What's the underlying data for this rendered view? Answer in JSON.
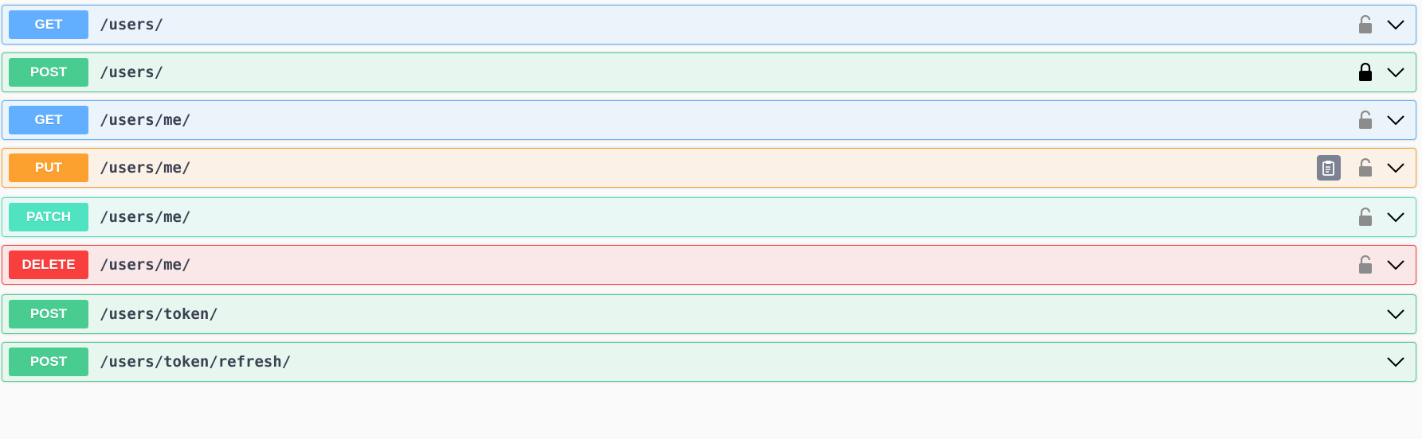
{
  "operations": [
    {
      "method": "GET",
      "path": "/users/",
      "lock": "unlocked",
      "copy": false
    },
    {
      "method": "POST",
      "path": "/users/",
      "lock": "locked",
      "copy": false
    },
    {
      "method": "GET",
      "path": "/users/me/",
      "lock": "unlocked",
      "copy": false
    },
    {
      "method": "PUT",
      "path": "/users/me/",
      "lock": "unlocked",
      "copy": true
    },
    {
      "method": "PATCH",
      "path": "/users/me/",
      "lock": "unlocked",
      "copy": false
    },
    {
      "method": "DELETE",
      "path": "/users/me/",
      "lock": "unlocked",
      "copy": false
    },
    {
      "method": "POST",
      "path": "/users/token/",
      "lock": "none",
      "copy": false
    },
    {
      "method": "POST",
      "path": "/users/token/refresh/",
      "lock": "none",
      "copy": false
    }
  ],
  "colors": {
    "get": "#61affe",
    "post": "#49cc90",
    "put": "#fca130",
    "patch": "#50e3c2",
    "delete": "#f93e3e",
    "lock_unlocked": "#8c8c8c",
    "lock_locked": "#000000"
  },
  "icons": {
    "lock_open": "unlocked-icon",
    "lock_closed": "locked-icon",
    "chevron": "chevron-down-icon",
    "copy": "copy-to-clipboard-icon"
  }
}
